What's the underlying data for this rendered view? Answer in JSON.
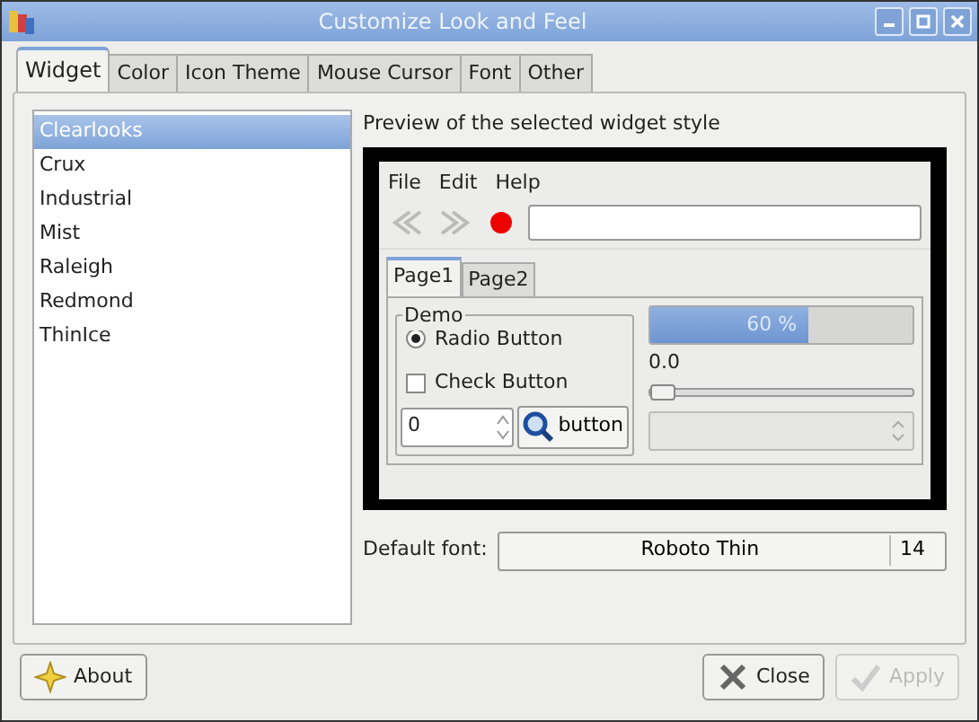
{
  "window": {
    "title": "Customize Look and Feel"
  },
  "tabs": [
    {
      "label": "Widget",
      "selected": true
    },
    {
      "label": "Color",
      "selected": false
    },
    {
      "label": "Icon Theme",
      "selected": false
    },
    {
      "label": "Mouse Cursor",
      "selected": false
    },
    {
      "label": "Font",
      "selected": false
    },
    {
      "label": "Other",
      "selected": false
    }
  ],
  "themes": [
    {
      "label": "Clearlooks",
      "selected": true
    },
    {
      "label": "Crux",
      "selected": false
    },
    {
      "label": "Industrial",
      "selected": false
    },
    {
      "label": "Mist",
      "selected": false
    },
    {
      "label": "Raleigh",
      "selected": false
    },
    {
      "label": "Redmond",
      "selected": false
    },
    {
      "label": "ThinIce",
      "selected": false
    }
  ],
  "preview": {
    "label": "Preview of the selected widget style",
    "menu": [
      "File",
      "Edit",
      "Help"
    ],
    "tabs": [
      {
        "label": "Page1",
        "selected": true
      },
      {
        "label": "Page2",
        "selected": false
      }
    ],
    "group": "Demo",
    "radio": {
      "label": "Radio Button",
      "checked": true
    },
    "check": {
      "label": "Check Button",
      "checked": false
    },
    "spin_value": "0",
    "button": "button",
    "progress": {
      "level": 0.6,
      "text": "60 %"
    },
    "scale": {
      "reading": "0.0",
      "level": 0
    },
    "combo": {
      "disabled": true
    }
  },
  "font": {
    "label": "Default font:",
    "name": "Roboto Thin",
    "size": "14"
  },
  "buttons": [
    {
      "label": "About",
      "kind": "about",
      "disabled": false
    },
    {
      "label": "Close",
      "kind": "close",
      "disabled": false
    },
    {
      "label": "Apply",
      "kind": "apply",
      "disabled": true
    }
  ]
}
